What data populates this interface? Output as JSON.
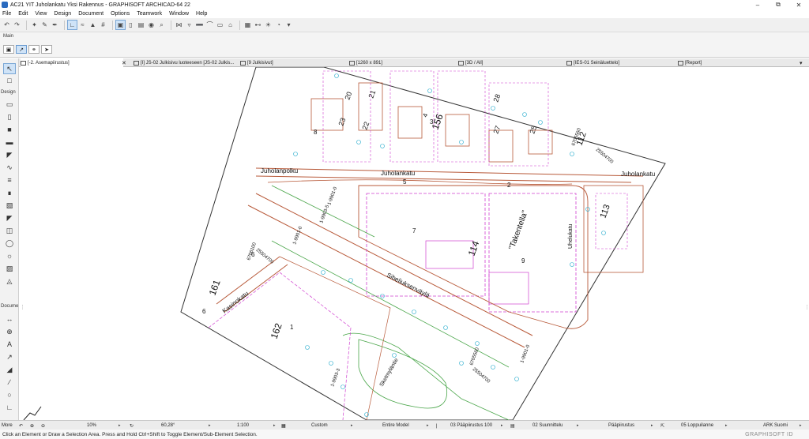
{
  "window": {
    "title": "AC21 YIT Juholankatu Yksi Rakennus - GRAPHISOFT ARCHICAD-64 22",
    "controls": [
      "minimize",
      "maximize",
      "close"
    ]
  },
  "menu": {
    "items": [
      "File",
      "Edit",
      "View",
      "Design",
      "Document",
      "Options",
      "Teamwork",
      "Window",
      "Help"
    ]
  },
  "infobox": {
    "label": "Main"
  },
  "tabs": [
    {
      "label": "[-2. Asemapiirustus]",
      "active": true
    },
    {
      "label": "[I] JS-02 Julkisivu luoteeseen [JS-02 Julkis...",
      "active": false
    },
    {
      "label": "[9 Julkisivut]",
      "active": false
    },
    {
      "label": "[1260 x 891]",
      "active": false
    },
    {
      "label": "[3D / All]",
      "active": false
    },
    {
      "label": "[IES-01 Seinäluettelo]",
      "active": false
    },
    {
      "label": "[Report]",
      "active": false
    }
  ],
  "toolbox": {
    "sections": [
      "Design",
      "Docume"
    ],
    "tools": [
      "arrow-select",
      "marquee",
      "wall",
      "column",
      "beam",
      "slab",
      "roof",
      "shell",
      "stair",
      "railing",
      "curtain-wall",
      "door",
      "window",
      "skylight",
      "object",
      "zone",
      "mesh",
      "morph",
      "dimension",
      "level",
      "text",
      "label",
      "fill",
      "line",
      "arc",
      "polyline"
    ]
  },
  "canvas": {
    "labels": {
      "street1": "Juholanpolku",
      "street2": "Juholankatu",
      "street3": "Juholankatu",
      "street4": "Sibeliuksenväylä",
      "street5": "Kasinokatu",
      "street6": "Uhelukatu",
      "street7": "Sketmyläntie",
      "block114": "114",
      "block156": "156",
      "block161": "161",
      "block162": "162",
      "block113": "113",
      "block112": "112",
      "planned": "\"Takentella\"",
      "code1": "1-9901-0",
      "code2": "1-9903-5",
      "code3": "1-9901-0",
      "code4": "1-9903-3",
      "code5": "1-9901-0",
      "num1": "6705560",
      "num2": "25504700",
      "num3": "6706100",
      "num4": "25504700",
      "num5": "6705560",
      "num6": "25504700",
      "lot22": "22",
      "lot23": "23",
      "lot21": "21",
      "lot20": "20",
      "lot28": "28",
      "lot27": "27",
      "lot25": "25",
      "lot4": "4",
      "lot2": "2",
      "lot5": "5",
      "lot6": "6",
      "lot7": "7",
      "lot9": "9",
      "lot3": "3",
      "lot8": "8",
      "lot1": "1",
      "lot6b": "6"
    }
  },
  "statusbar": {
    "zoom": "10%",
    "angle": "60,28°",
    "scale": "1:100",
    "layer_combo": "Custom",
    "model_view": "Entire Model",
    "pen_set": "03 Pääpiirustus 100",
    "renovation": "02 Suunnittelu",
    "mvo": "Pääpiirustus",
    "dimension": "05 Loppuilanne",
    "language": "ARK Suomi"
  },
  "hint": {
    "text": "Click an Element or Draw a Selection Area. Press and Hold Ctrl+Shift to Toggle Element/Sub-Element Selection."
  },
  "brand": {
    "text": "GRAPHISOFT ID"
  },
  "more_label": "More"
}
